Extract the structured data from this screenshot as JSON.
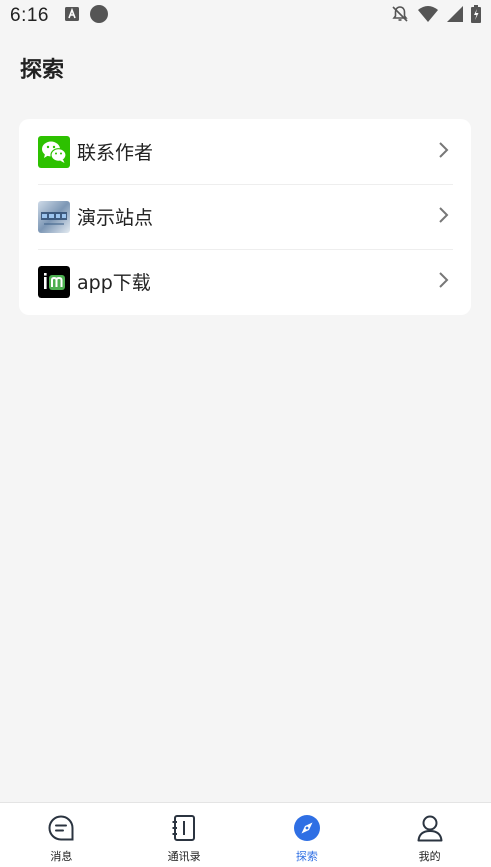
{
  "status_bar": {
    "time": "6:16",
    "icons": [
      "font-a-icon",
      "circle-icon",
      "bell-off-icon",
      "wifi-icon",
      "signal-icon",
      "battery-charging-icon"
    ]
  },
  "page": {
    "title": "探索"
  },
  "menu": {
    "items": [
      {
        "label": "联系作者",
        "icon": "wechat-icon",
        "icon_bg": "#2dc100"
      },
      {
        "label": "演示站点",
        "icon": "site-thumbnail-icon",
        "icon_bg": "#8da5c0"
      },
      {
        "label": "app下载",
        "icon": "app-logo-icon",
        "icon_bg": "#000000"
      }
    ]
  },
  "tab_bar": {
    "active": 2,
    "accent": "#2f6fe4",
    "tabs": [
      {
        "label": "消息",
        "icon": "chat-icon"
      },
      {
        "label": "通讯录",
        "icon": "contacts-book-icon"
      },
      {
        "label": "探索",
        "icon": "compass-icon"
      },
      {
        "label": "我的",
        "icon": "user-icon"
      }
    ]
  }
}
